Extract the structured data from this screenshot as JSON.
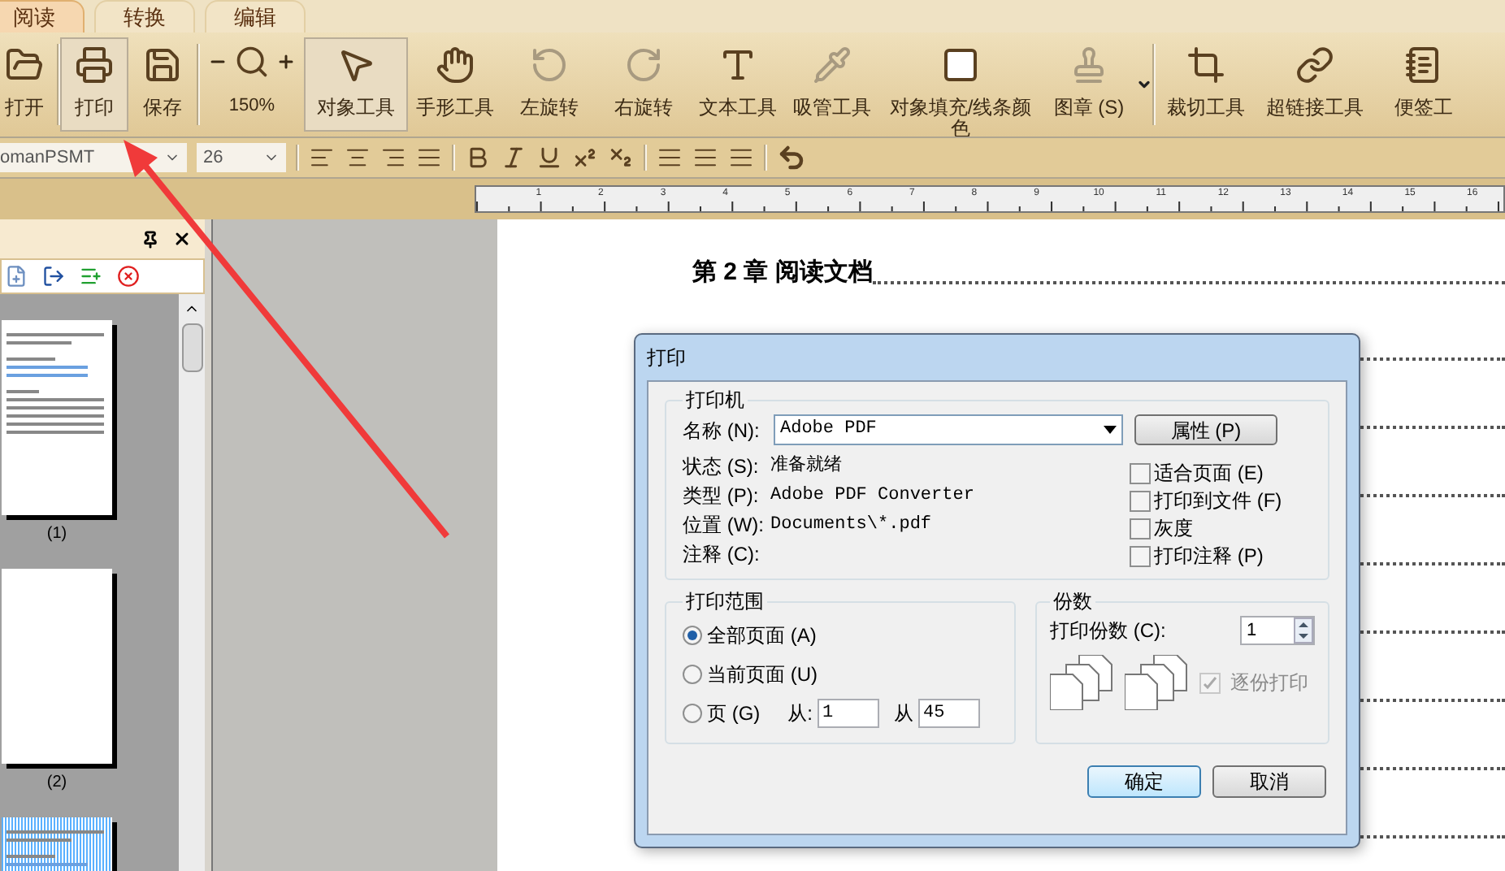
{
  "tabs": [
    {
      "label": "阅读",
      "selected": true
    },
    {
      "label": "转换",
      "selected": false
    },
    {
      "label": "编辑",
      "selected": false
    }
  ],
  "toolbar": {
    "tools": [
      {
        "label": "打开",
        "selected": false,
        "disabled": false
      },
      {
        "label": "打印",
        "selected": true,
        "disabled": false
      },
      {
        "label": "保存",
        "selected": false,
        "disabled": false
      }
    ],
    "zoom": {
      "label": "150%"
    },
    "tools_2": [
      {
        "label": "对象工具",
        "selected": true,
        "disabled": false
      },
      {
        "label": "手形工具",
        "selected": false,
        "disabled": false
      },
      {
        "label": "左旋转",
        "selected": false,
        "disabled": true
      },
      {
        "label": "右旋转",
        "selected": false,
        "disabled": true
      },
      {
        "label": "文本工具",
        "selected": false,
        "disabled": false
      },
      {
        "label": "吸管工具",
        "selected": false,
        "disabled": true
      },
      {
        "label": "对象填充/线条颜色",
        "selected": false,
        "disabled": false
      },
      {
        "label": "图章 (S)",
        "selected": false,
        "disabled": true
      }
    ],
    "tools_3": [
      {
        "label": "裁切工具",
        "selected": false,
        "disabled": false
      },
      {
        "label": "超链接工具",
        "selected": false,
        "disabled": false
      },
      {
        "label": "便签工",
        "selected": false,
        "disabled": false
      }
    ]
  },
  "format_bar": {
    "font": "omanPSMT",
    "size": "26"
  },
  "ruler": {
    "labels": [
      "1",
      "2",
      "3",
      "4",
      "5",
      "6",
      "7",
      "8",
      "9",
      "10",
      "11",
      "12",
      "13",
      "14",
      "15",
      "16"
    ]
  },
  "thumbnails": [
    {
      "label": "(1)",
      "kind": "content",
      "selected": false
    },
    {
      "label": "(2)",
      "kind": "blank",
      "selected": false
    },
    {
      "kind": "content",
      "selected": true
    }
  ],
  "page": {
    "heading": "第 2 章  阅读文档"
  },
  "dialog": {
    "title": "打印",
    "printer": {
      "legend": "打印机",
      "name_label": "名称 (N):",
      "name_value": "Adobe PDF",
      "properties_button": "属性 (P)",
      "info": [
        {
          "label": "状态 (S):",
          "value": "准备就绪"
        },
        {
          "label": "类型 (P):",
          "value": "Adobe PDF Converter"
        },
        {
          "label": "位置 (W):",
          "value": "Documents\\*.pdf"
        },
        {
          "label": "注释 (C):"
        }
      ],
      "options": [
        {
          "label": "适合页面 (E)",
          "checked": false
        },
        {
          "label": "打印到文件 (F)",
          "checked": false
        },
        {
          "label": "灰度",
          "checked": false
        },
        {
          "label": "打印注释 (P)",
          "checked": false
        }
      ]
    },
    "range": {
      "legend": "打印范围",
      "options": [
        {
          "label": "全部页面 (A)",
          "selected": true
        },
        {
          "label": "当前页面 (U)",
          "selected": false
        },
        {
          "label": "页 (G)",
          "selected": false
        }
      ],
      "from_label": "从:",
      "from": "1",
      "to_label": "从",
      "to": "45"
    },
    "copies": {
      "legend": "份数",
      "label": "打印份数 (C):",
      "value": "1",
      "collate": {
        "label": "逐份打印",
        "checked": true,
        "disabled": true
      }
    },
    "buttons": [
      {
        "label": "确定",
        "default": true
      },
      {
        "label": "取消",
        "default": false
      }
    ]
  }
}
